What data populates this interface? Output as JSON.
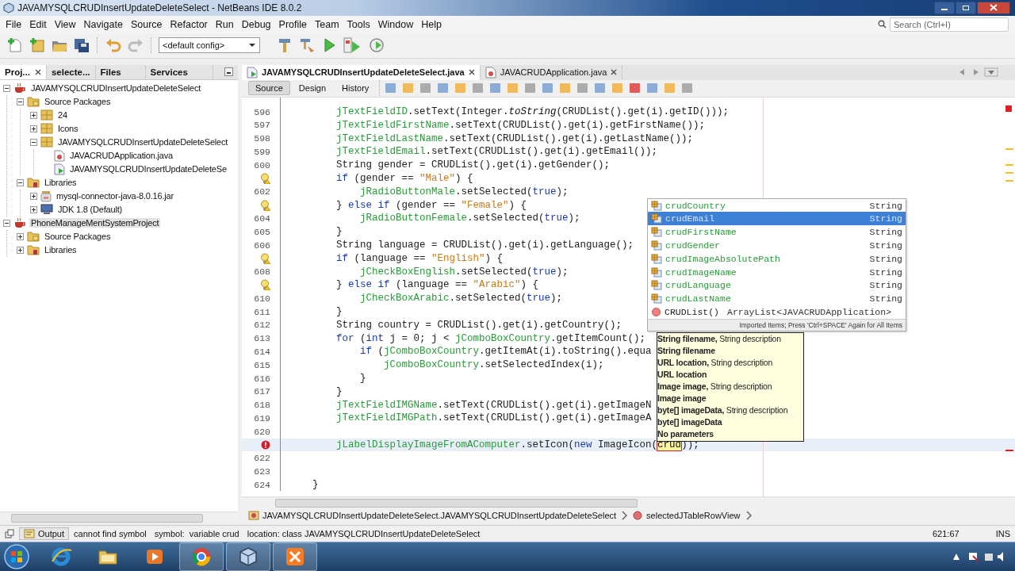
{
  "window": {
    "title": "JAVAMYSQLCRUDInsertUpdateDeleteSelect - NetBeans IDE 8.0.2"
  },
  "menu": [
    "File",
    "Edit",
    "View",
    "Navigate",
    "Source",
    "Refactor",
    "Run",
    "Debug",
    "Profile",
    "Team",
    "Tools",
    "Window",
    "Help"
  ],
  "toolbar": {
    "config": "<default config>",
    "search": {
      "placeholder": "Search (Ctrl+I)"
    }
  },
  "project_panel": {
    "tabs": [
      {
        "label": "Proj...",
        "selected": true
      },
      {
        "label": "selecte...",
        "selected": false
      },
      {
        "label": "Files",
        "selected": false
      },
      {
        "label": "Services",
        "selected": false
      }
    ],
    "tree": [
      {
        "label": "JAVAMYSQLCRUDInsertUpdateDeleteSelect",
        "kind": "project",
        "expanded": true,
        "selected": false,
        "children": [
          {
            "label": "Source Packages",
            "kind": "source-folder",
            "expanded": true,
            "selected": false,
            "children": [
              {
                "label": "24",
                "kind": "package",
                "expanded": false,
                "selected": false
              },
              {
                "label": "Icons",
                "kind": "package",
                "expanded": false,
                "selected": false
              },
              {
                "label": "JAVAMYSQLCRUDInsertUpdateDeleteSelect",
                "kind": "package",
                "expanded": true,
                "selected": false,
                "children": [
                  {
                    "label": "JAVACRUDApplication.java",
                    "kind": "java-class",
                    "selected": false
                  },
                  {
                    "label": "JAVAMYSQLCRUDInsertUpdateDeleteSe",
                    "kind": "form-class",
                    "selected": false
                  }
                ]
              }
            ]
          },
          {
            "label": "Libraries",
            "kind": "library-folder",
            "expanded": true,
            "selected": false,
            "children": [
              {
                "label": "mysql-connector-java-8.0.16.jar",
                "kind": "jar",
                "expanded": false,
                "selected": false
              },
              {
                "label": "JDK 1.8 (Default)",
                "kind": "jdk",
                "expanded": false,
                "selected": false
              }
            ]
          }
        ]
      },
      {
        "label": "PhoneManageMentSystemProject",
        "kind": "project",
        "expanded": true,
        "selected": true,
        "children": [
          {
            "label": "Source Packages",
            "kind": "source-folder",
            "expanded": false,
            "selected": false
          },
          {
            "label": "Libraries",
            "kind": "library-folder",
            "expanded": false,
            "selected": false
          }
        ]
      }
    ]
  },
  "editor": {
    "tabs": [
      {
        "label": "JAVAMYSQLCRUDInsertUpdateDeleteSelect.java",
        "kind": "form-class",
        "selected": true
      },
      {
        "label": "JAVACRUDApplication.java",
        "kind": "java-class",
        "selected": false
      }
    ],
    "views": [
      {
        "label": "Source",
        "selected": true
      },
      {
        "label": "Design",
        "selected": false
      },
      {
        "label": "History",
        "selected": false
      }
    ],
    "lines": [
      {
        "number": "596",
        "kind": "code",
        "current": false,
        "tokens": [
          {
            "kind": "field",
            "text": "        jTextFieldID"
          },
          {
            "kind": "plain",
            "text": ".setText(Integer."
          },
          {
            "kind": "static",
            "text": "toString"
          },
          {
            "kind": "plain",
            "text": "(CRUDList().get(i).getID()));"
          }
        ]
      },
      {
        "number": "597",
        "kind": "code",
        "current": false,
        "tokens": [
          {
            "kind": "field",
            "text": "        jTextFieldFirstName"
          },
          {
            "kind": "plain",
            "text": ".setText(CRUDList().get(i).getFirstName());"
          }
        ]
      },
      {
        "number": "598",
        "kind": "code",
        "current": false,
        "tokens": [
          {
            "kind": "field",
            "text": "        jTextFieldLastName"
          },
          {
            "kind": "plain",
            "text": ".setText(CRUDList().get(i).getLastName());"
          }
        ]
      },
      {
        "number": "599",
        "kind": "code",
        "current": false,
        "tokens": [
          {
            "kind": "field",
            "text": "        jTextFieldEmail"
          },
          {
            "kind": "plain",
            "text": ".setText(CRUDList().get(i).getEmail());"
          }
        ]
      },
      {
        "number": "600",
        "kind": "code",
        "current": false,
        "tokens": [
          {
            "kind": "plain",
            "text": "        String gender = CRUDList().get(i).getGender();"
          }
        ]
      },
      {
        "kind": "hint",
        "current": false,
        "tokens": [
          {
            "kind": "keyword",
            "text": "        if"
          },
          {
            "kind": "plain",
            "text": " (gender == "
          },
          {
            "kind": "string",
            "text": "\"Male\""
          },
          {
            "kind": "plain",
            "text": ") {"
          }
        ]
      },
      {
        "number": "602",
        "kind": "code",
        "current": false,
        "tokens": [
          {
            "kind": "field",
            "text": "            jRadioButtonMale"
          },
          {
            "kind": "plain",
            "text": ".setSelected("
          },
          {
            "kind": "keyword",
            "text": "true"
          },
          {
            "kind": "plain",
            "text": ");"
          }
        ]
      },
      {
        "kind": "hint",
        "current": false,
        "tokens": [
          {
            "kind": "plain",
            "text": "        } "
          },
          {
            "kind": "keyword",
            "text": "else if"
          },
          {
            "kind": "plain",
            "text": " (gender == "
          },
          {
            "kind": "string",
            "text": "\"Female\""
          },
          {
            "kind": "plain",
            "text": ") {"
          }
        ]
      },
      {
        "number": "604",
        "kind": "code",
        "current": false,
        "tokens": [
          {
            "kind": "field",
            "text": "            jRadioButtonFemale"
          },
          {
            "kind": "plain",
            "text": ".setSelected("
          },
          {
            "kind": "keyword",
            "text": "true"
          },
          {
            "kind": "plain",
            "text": ");"
          }
        ]
      },
      {
        "number": "605",
        "kind": "code",
        "current": false,
        "tokens": [
          {
            "kind": "plain",
            "text": "        }"
          }
        ]
      },
      {
        "number": "606",
        "kind": "code",
        "current": false,
        "tokens": [
          {
            "kind": "plain",
            "text": "        String language = CRUDList().get(i).getLanguage();"
          }
        ]
      },
      {
        "kind": "hint",
        "current": false,
        "tokens": [
          {
            "kind": "keyword",
            "text": "        if"
          },
          {
            "kind": "plain",
            "text": " (language == "
          },
          {
            "kind": "string",
            "text": "\"English\""
          },
          {
            "kind": "plain",
            "text": ") {"
          }
        ]
      },
      {
        "number": "608",
        "kind": "code",
        "current": false,
        "tokens": [
          {
            "kind": "field",
            "text": "            jCheckBoxEnglish"
          },
          {
            "kind": "plain",
            "text": ".setSelected("
          },
          {
            "kind": "keyword",
            "text": "true"
          },
          {
            "kind": "plain",
            "text": ");"
          }
        ]
      },
      {
        "kind": "hint",
        "current": false,
        "tokens": [
          {
            "kind": "plain",
            "text": "        } "
          },
          {
            "kind": "keyword",
            "text": "else if"
          },
          {
            "kind": "plain",
            "text": " (language == "
          },
          {
            "kind": "string",
            "text": "\"Arabic\""
          },
          {
            "kind": "plain",
            "text": ") {"
          }
        ]
      },
      {
        "number": "610",
        "kind": "code",
        "current": false,
        "tokens": [
          {
            "kind": "field",
            "text": "            jCheckBoxArabic"
          },
          {
            "kind": "plain",
            "text": ".setSelected("
          },
          {
            "kind": "keyword",
            "text": "true"
          },
          {
            "kind": "plain",
            "text": ");"
          }
        ]
      },
      {
        "number": "611",
        "kind": "code",
        "current": false,
        "tokens": [
          {
            "kind": "plain",
            "text": "        }"
          }
        ]
      },
      {
        "number": "612",
        "kind": "code",
        "current": false,
        "tokens": [
          {
            "kind": "plain",
            "text": "        String country = CRUDList().get(i).getCountry();"
          }
        ]
      },
      {
        "number": "613",
        "kind": "code",
        "current": false,
        "tokens": [
          {
            "kind": "keyword",
            "text": "        for"
          },
          {
            "kind": "plain",
            "text": " ("
          },
          {
            "kind": "keyword",
            "text": "int"
          },
          {
            "kind": "plain",
            "text": " j = 0; j < "
          },
          {
            "kind": "field",
            "text": "jComboBoxCountry"
          },
          {
            "kind": "plain",
            "text": ".getItemCount();"
          }
        ]
      },
      {
        "number": "614",
        "kind": "code",
        "current": false,
        "tokens": [
          {
            "kind": "keyword",
            "text": "            if"
          },
          {
            "kind": "plain",
            "text": " ("
          },
          {
            "kind": "field",
            "text": "jComboBoxCountry"
          },
          {
            "kind": "plain",
            "text": ".getItemAt(i).toString().equa"
          }
        ]
      },
      {
        "number": "615",
        "kind": "code",
        "current": false,
        "tokens": [
          {
            "kind": "field",
            "text": "                jComboBoxCountry"
          },
          {
            "kind": "plain",
            "text": ".setSelectedIndex(i);"
          }
        ]
      },
      {
        "number": "616",
        "kind": "code",
        "current": false,
        "tokens": [
          {
            "kind": "plain",
            "text": "            }"
          }
        ]
      },
      {
        "number": "617",
        "kind": "code",
        "current": false,
        "tokens": [
          {
            "kind": "plain",
            "text": "        }"
          }
        ]
      },
      {
        "number": "618",
        "kind": "code",
        "current": false,
        "tokens": [
          {
            "kind": "field",
            "text": "        jTextFieldIMGName"
          },
          {
            "kind": "plain",
            "text": ".setText(CRUDList().get(i).getImageN"
          }
        ]
      },
      {
        "number": "619",
        "kind": "code",
        "current": false,
        "tokens": [
          {
            "kind": "field",
            "text": "        jTextFieldIMGPath"
          },
          {
            "kind": "plain",
            "text": ".setText(CRUDList().get(i).getImageA"
          }
        ]
      },
      {
        "number": "620",
        "kind": "code",
        "current": false
      },
      {
        "kind": "error",
        "current": true,
        "tokens": [
          {
            "kind": "field",
            "text": "        jLabelDisplayImageFromAComputer"
          },
          {
            "kind": "plain",
            "text": ".setIcon("
          },
          {
            "kind": "keyword",
            "text": "new"
          },
          {
            "kind": "plain",
            "text": " ImageIcon("
          },
          {
            "kind": "match",
            "text": "crud"
          },
          {
            "kind": "plain",
            "text": "));"
          }
        ]
      },
      {
        "number": "622",
        "kind": "code",
        "current": false
      },
      {
        "number": "623",
        "kind": "code",
        "current": false
      },
      {
        "number": "624",
        "kind": "code",
        "current": false,
        "tokens": [
          {
            "kind": "plain",
            "text": "    }"
          }
        ]
      }
    ],
    "breadcrumb": [
      {
        "kind": "class",
        "label": "JAVAMYSQLCRUDInsertUpdateDeleteSelect.JAVAMYSQLCRUDInsertUpdateDeleteSelect"
      },
      {
        "kind": "method",
        "label": "selectedJTableRowView"
      }
    ]
  },
  "completion": {
    "items": [
      {
        "kind": "field",
        "name": "crudCountry",
        "type": "String",
        "selected": false
      },
      {
        "kind": "field",
        "name": "crudEmail",
        "type": "String",
        "selected": true
      },
      {
        "kind": "field",
        "name": "crudFirstName",
        "type": "String",
        "selected": false
      },
      {
        "kind": "field",
        "name": "crudGender",
        "type": "String",
        "selected": false
      },
      {
        "kind": "field",
        "name": "crudImageAbsolutePath",
        "type": "String",
        "selected": false
      },
      {
        "kind": "field",
        "name": "crudImageName",
        "type": "String",
        "selected": false
      },
      {
        "kind": "field",
        "name": "crudLanguage",
        "type": "String",
        "selected": false
      },
      {
        "kind": "field",
        "name": "crudLastName",
        "type": "String",
        "selected": false
      },
      {
        "kind": "method",
        "name": "CRUDList()",
        "type": "ArrayList<JAVACRUDApplication>",
        "selected": false
      }
    ],
    "footer": "Imported Items; Press 'Ctrl+SPACE' Again for All Items"
  },
  "tooltip": {
    "lines": [
      "**String filename,** String description",
      "**String filename**",
      "**URL location,** String description",
      "**URL location**",
      "**Image image,** String description",
      "**Image image**",
      "**byte[] imageData,** String description",
      "**byte[] imageData**",
      "**No parameters**"
    ]
  },
  "status": {
    "output_label": "Output",
    "messages": [
      "cannot find symbol",
      "symbol:  variable crud",
      "location: class JAVAMYSQLCRUDInsertUpdateDeleteSelect"
    ],
    "position": "621:67",
    "mode": "INS"
  },
  "taskbar": {
    "apps": [
      {
        "kind": "browser-e",
        "running": false
      },
      {
        "kind": "folder",
        "running": false
      },
      {
        "kind": "media",
        "running": false
      },
      {
        "kind": "chrome",
        "running": true
      },
      {
        "kind": "cube",
        "running": true
      },
      {
        "kind": "xampp",
        "running": true
      }
    ]
  }
}
